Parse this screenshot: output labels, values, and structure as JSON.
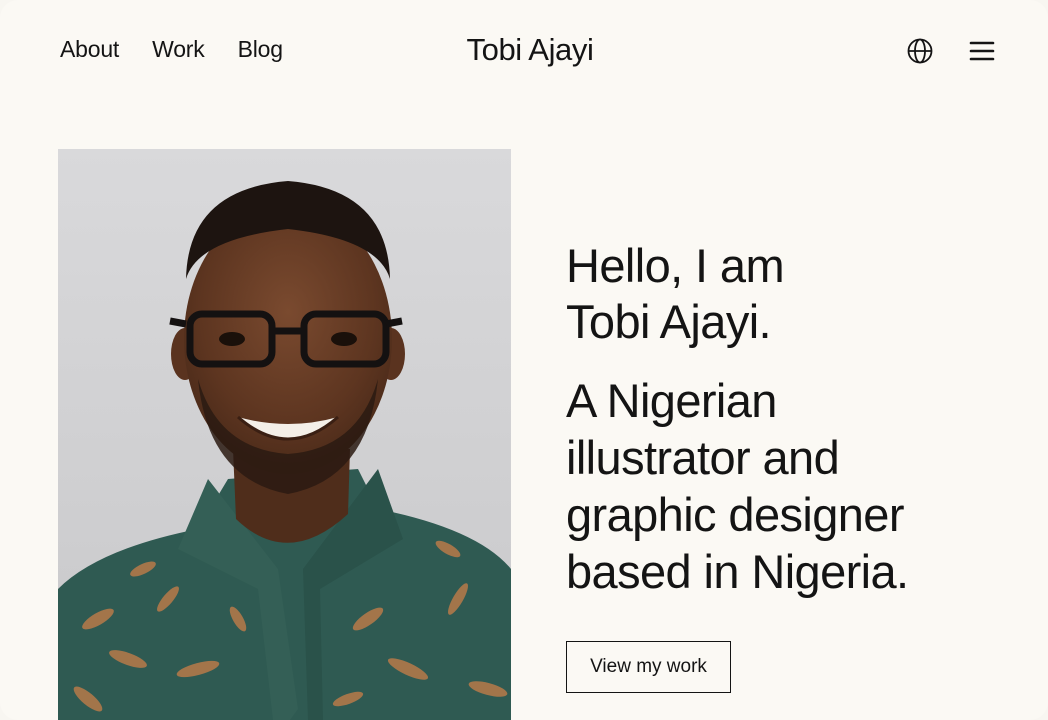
{
  "header": {
    "nav": [
      {
        "label": "About"
      },
      {
        "label": "Work"
      },
      {
        "label": "Blog"
      }
    ],
    "brand": "Tobi Ajayi",
    "icons": {
      "language": "globe-icon",
      "menu": "hamburger-menu-icon"
    }
  },
  "hero": {
    "greeting_line1": "Hello, I am",
    "greeting_line2": "Tobi Ajayi.",
    "tagline_line1": "A Nigerian",
    "tagline_line2": "illustrator and",
    "tagline_line3": "graphic designer",
    "tagline_line4": "based in Nigeria.",
    "cta_label": "View my work"
  },
  "colors": {
    "background": "#fbf9f4",
    "text": "#141414",
    "shirt": "#2f5a52",
    "leaf": "#b0784a"
  }
}
